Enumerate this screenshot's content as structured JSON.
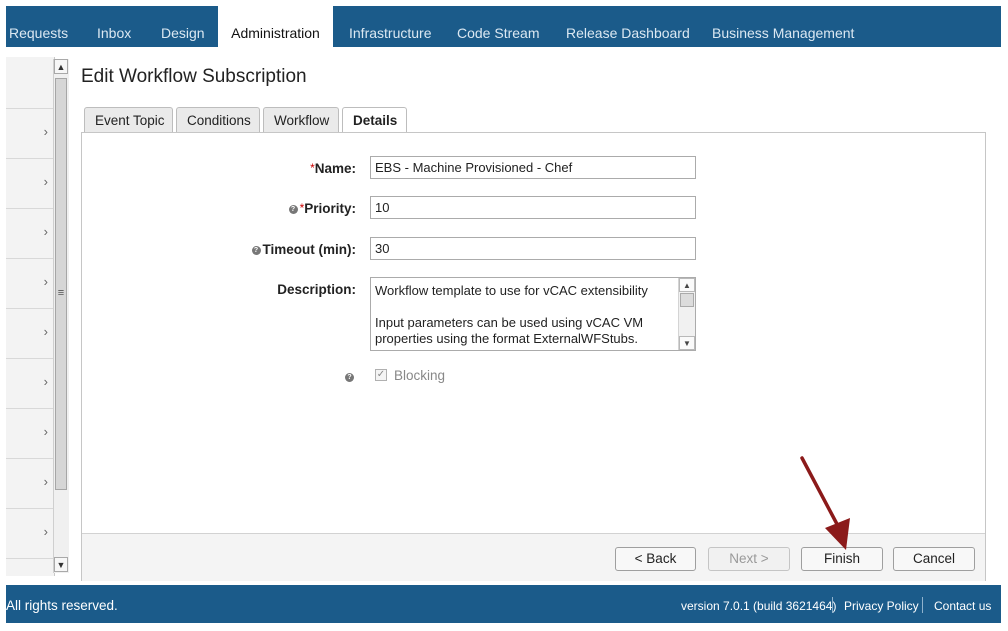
{
  "nav": {
    "tabs": [
      {
        "label": "Requests"
      },
      {
        "label": "Inbox"
      },
      {
        "label": "Design"
      },
      {
        "label": "Administration",
        "active": true
      },
      {
        "label": "Infrastructure"
      },
      {
        "label": "Code Stream"
      },
      {
        "label": "Release Dashboard"
      },
      {
        "label": "Business Management"
      }
    ]
  },
  "page": {
    "title": "Edit Workflow Subscription",
    "tabs": [
      {
        "label": "Event Topic"
      },
      {
        "label": "Conditions"
      },
      {
        "label": "Workflow"
      },
      {
        "label": "Details",
        "active": true
      }
    ]
  },
  "form": {
    "name_label": "Name:",
    "name_value": "EBS - Machine Provisioned - Chef",
    "priority_label": "Priority:",
    "priority_value": "10",
    "timeout_label": "Timeout (min):",
    "timeout_value": "30",
    "description_label": "Description:",
    "description_line1": "Workflow template to use for vCAC extensibility",
    "description_line2": "Input parameters can be used using vCAC VM properties using the format ExternalWFStubs.",
    "blocking_label": "Blocking",
    "blocking_checked": true,
    "required_marker": "*"
  },
  "buttons": {
    "back": "< Back",
    "next": "Next >",
    "finish": "Finish",
    "cancel": "Cancel"
  },
  "footer": {
    "copyright": "All rights reserved.",
    "version": "version 7.0.1 (build 3621464)",
    "privacy": "Privacy Policy",
    "contact": "Contact us"
  },
  "icons": {
    "help": "help-icon",
    "chevron": "chevron-right-icon",
    "checkmark": "checkmark-icon",
    "arrow": "annotation-arrow-icon"
  },
  "colors": {
    "header_bg": "#1b5b8a",
    "arrow": "#8b1a1a"
  }
}
